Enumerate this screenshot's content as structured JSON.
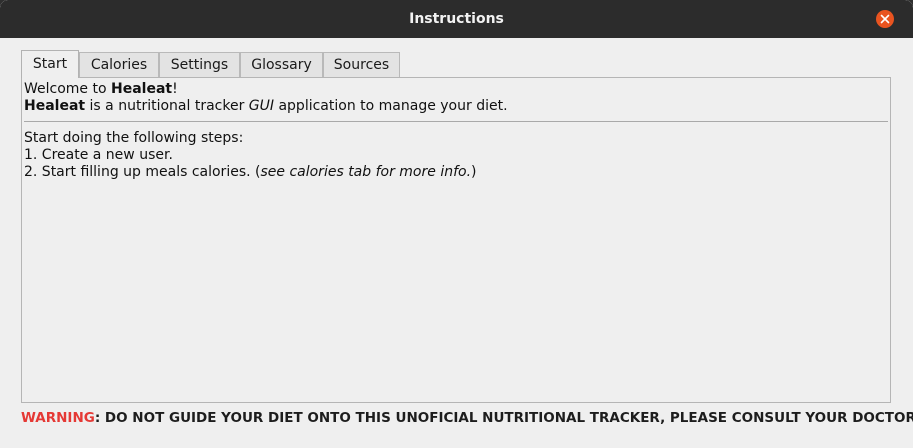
{
  "window": {
    "title": "Instructions"
  },
  "tabs": [
    {
      "label": "Start",
      "active": true
    },
    {
      "label": "Calories",
      "active": false
    },
    {
      "label": "Settings",
      "active": false
    },
    {
      "label": "Glossary",
      "active": false
    },
    {
      "label": "Sources",
      "active": false
    }
  ],
  "welcome": {
    "line1_prefix": "Welcome to ",
    "line1_app": "Healeat",
    "line1_suffix": "!",
    "line2_app": "Healeat",
    "line2_mid": " is a nutritional tracker ",
    "line2_gui": "GUI",
    "line2_suffix": " application to manage your diet."
  },
  "steps": {
    "intro": "Start doing the following steps:",
    "step1": "1. Create a new user.",
    "step2_prefix": "2. Start filling up meals calories. (",
    "step2_italic": "see calories tab for more info.",
    "step2_suffix": ")"
  },
  "footer": {
    "warning_label": "WARNING",
    "warning_text": ": DO NOT GUIDE YOUR DIET ONTO THIS UNOFICIAL NUTRITIONAL TRACKER, PLEASE CONSULT YOUR DOCTOR."
  },
  "colors": {
    "titlebar": "#2c2c2c",
    "close_button": "#e95420",
    "warning": "#e53935"
  }
}
